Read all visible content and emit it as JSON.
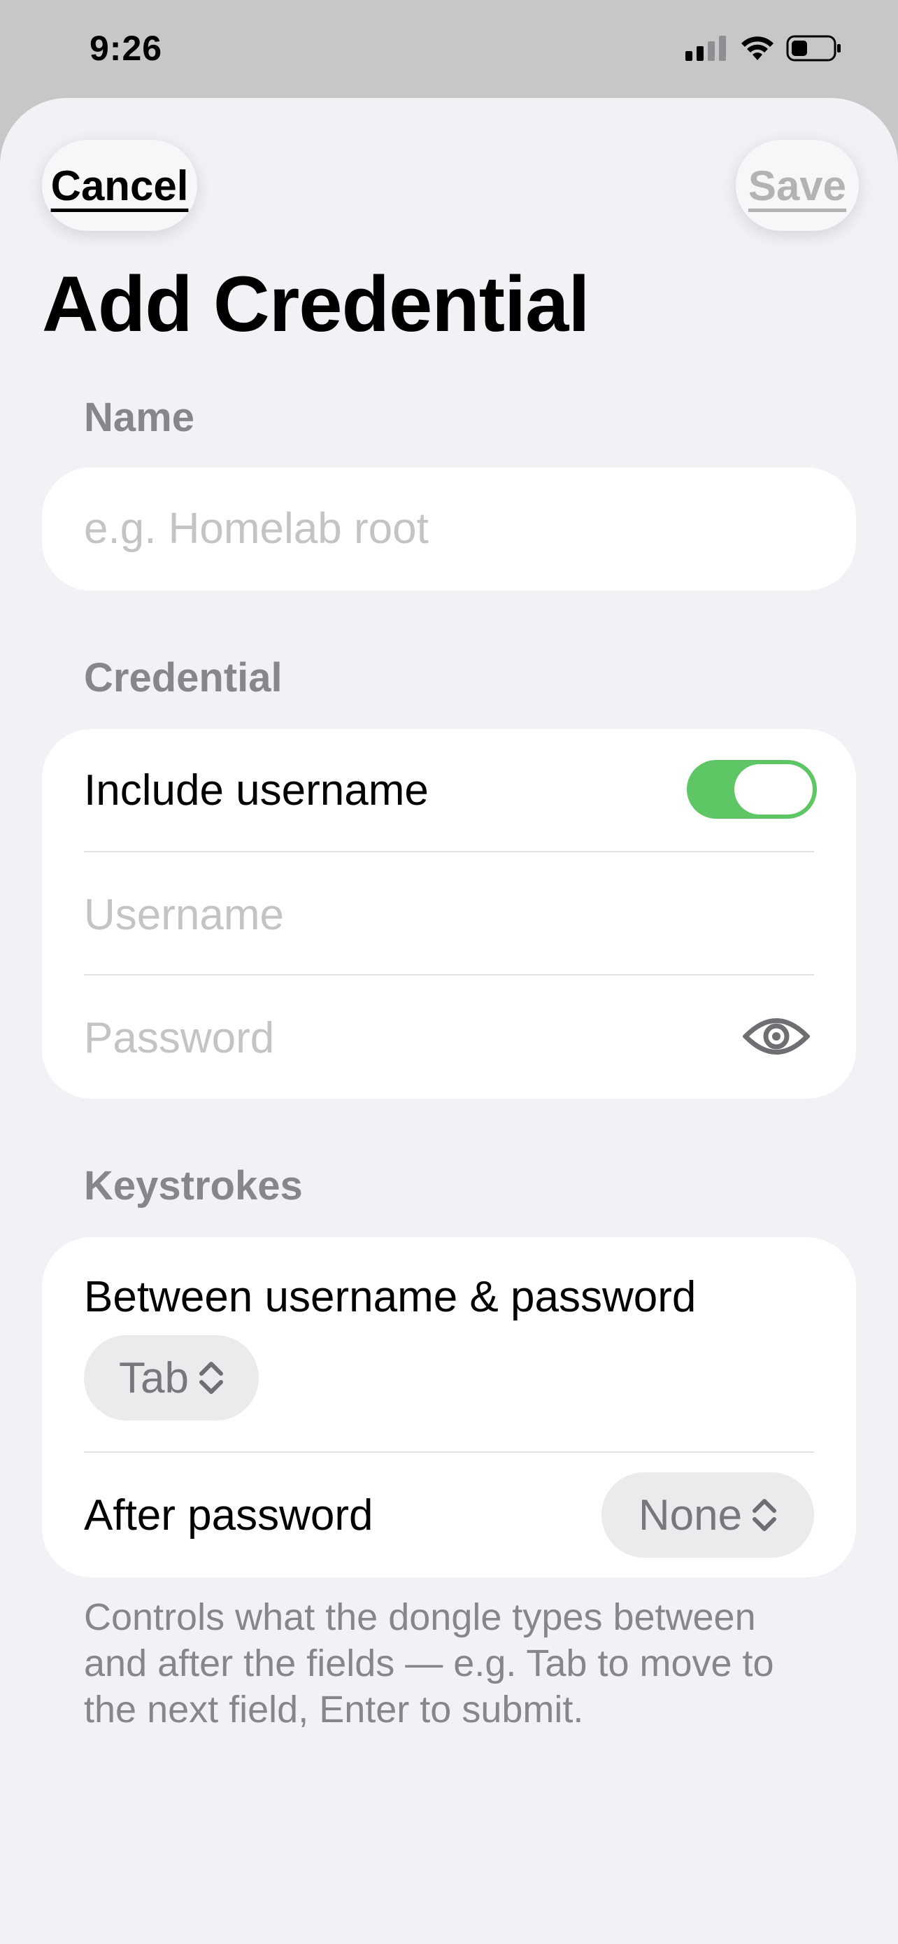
{
  "status_bar": {
    "time": "9:26"
  },
  "nav": {
    "cancel_label": "Cancel",
    "save_label": "Save"
  },
  "title": "Add Credential",
  "name_section": {
    "label": "Name",
    "placeholder": "e.g. Homelab root"
  },
  "credential_section": {
    "label": "Credential",
    "include_username_label": "Include username",
    "include_username_on": true,
    "username_placeholder": "Username",
    "password_placeholder": "Password"
  },
  "keystrokes_section": {
    "label": "Keystrokes",
    "between_label": "Between username & password",
    "between_value": "Tab",
    "after_label": "After password",
    "after_value": "None",
    "footer": "Controls what the dongle types between and after the fields — e.g. Tab to move to the next field, Enter to submit."
  },
  "colors": {
    "toggle_on": "#5fc665",
    "secondary_text": "#86868b",
    "background": "#f1f1f6"
  }
}
